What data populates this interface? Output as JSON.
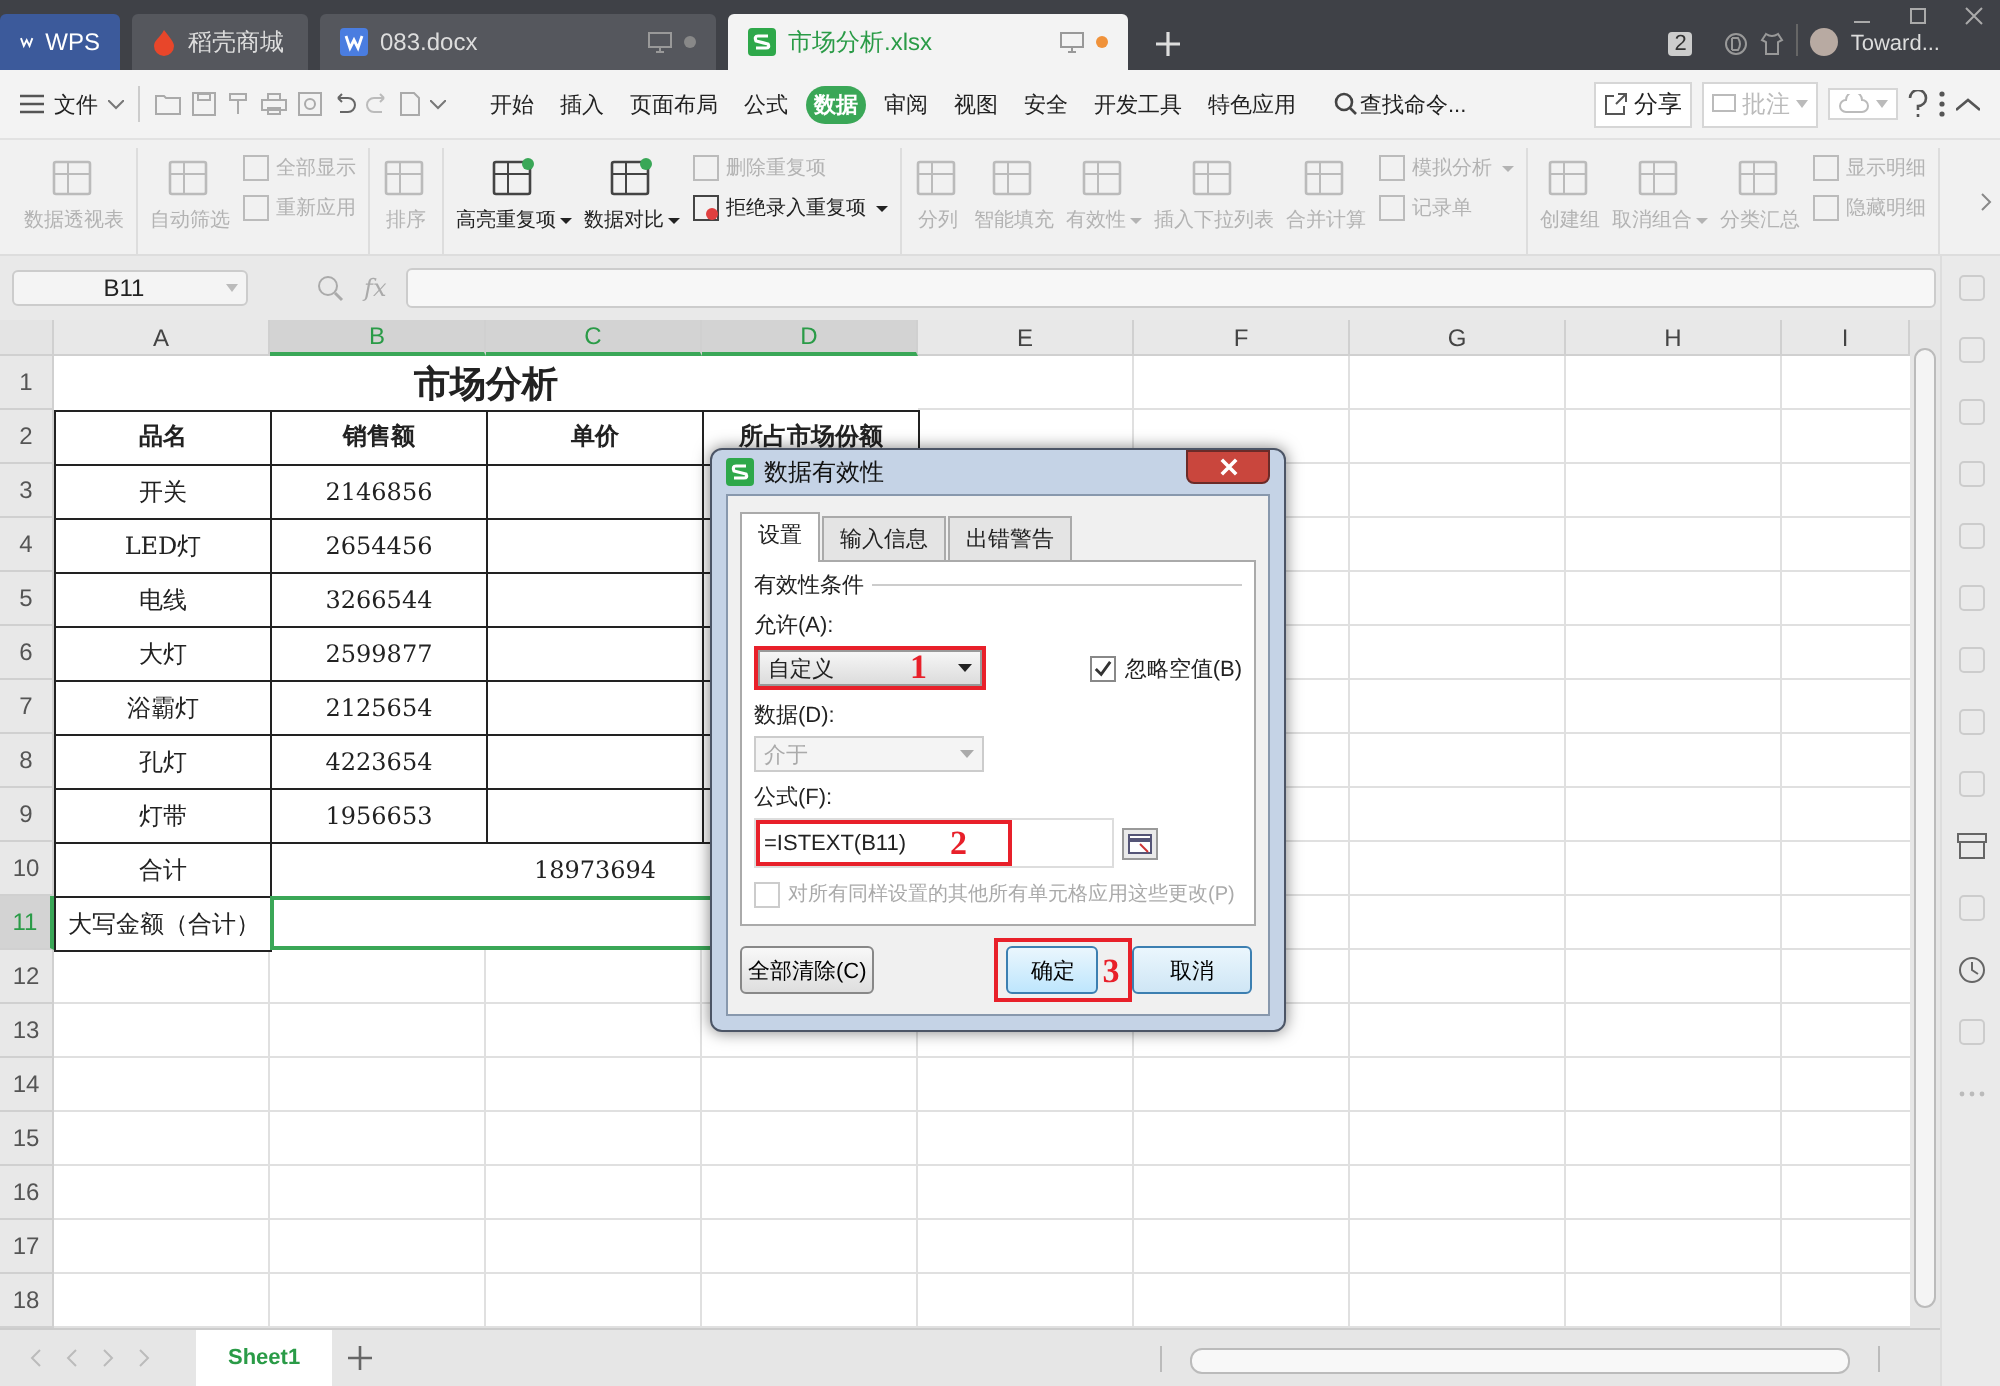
{
  "title_bar": {
    "tabs": [
      {
        "label": "WPS",
        "kind": "home",
        "selected": false
      },
      {
        "label": "稻壳商城",
        "kind": "store",
        "selected": false
      },
      {
        "label": "083.docx",
        "kind": "doc",
        "selected": false
      },
      {
        "label": "市场分析.xlsx",
        "kind": "sheet",
        "selected": true
      }
    ],
    "badge": "2",
    "user": "Toward..."
  },
  "menu_bar": {
    "file": "文件",
    "items": [
      {
        "label": "开始",
        "selected": false
      },
      {
        "label": "插入",
        "selected": false
      },
      {
        "label": "页面布局",
        "selected": false
      },
      {
        "label": "公式",
        "selected": false
      },
      {
        "label": "数据",
        "selected": true
      },
      {
        "label": "审阅",
        "selected": false
      },
      {
        "label": "视图",
        "selected": false
      },
      {
        "label": "安全",
        "selected": false
      },
      {
        "label": "开发工具",
        "selected": false
      },
      {
        "label": "特色应用",
        "selected": false
      }
    ],
    "search": "查找命令...",
    "share": "分享",
    "comment": "批注"
  },
  "ribbon": {
    "groups": [
      {
        "items": [
          {
            "kind": "large",
            "label": "数据透视表",
            "disabled": true,
            "dropdown": false
          }
        ]
      },
      {
        "items": [
          {
            "kind": "large",
            "label": "自动筛选",
            "disabled": true,
            "dropdown": false
          },
          {
            "kind": "stack",
            "items": [
              {
                "label": "全部显示",
                "disabled": true,
                "dropdown": false
              },
              {
                "label": "重新应用",
                "disabled": true,
                "dropdown": false
              }
            ]
          }
        ]
      },
      {
        "items": [
          {
            "kind": "large",
            "label": "排序",
            "disabled": true,
            "dropdown": false
          }
        ]
      },
      {
        "items": [
          {
            "kind": "large",
            "label": "高亮重复项",
            "disabled": false,
            "dropdown": true
          },
          {
            "kind": "large",
            "label": "数据对比",
            "disabled": false,
            "dropdown": true
          },
          {
            "kind": "stack",
            "items": [
              {
                "label": "删除重复项",
                "disabled": true,
                "dropdown": false
              },
              {
                "label": "拒绝录入重复项",
                "disabled": false,
                "dropdown": true
              }
            ]
          }
        ]
      },
      {
        "items": [
          {
            "kind": "large",
            "label": "分列",
            "disabled": true,
            "dropdown": false
          },
          {
            "kind": "large",
            "label": "智能填充",
            "disabled": true,
            "dropdown": false
          },
          {
            "kind": "large",
            "label": "有效性",
            "disabled": true,
            "dropdown": true
          },
          {
            "kind": "large",
            "label": "插入下拉列表",
            "disabled": true,
            "dropdown": false
          },
          {
            "kind": "large",
            "label": "合并计算",
            "disabled": true,
            "dropdown": false
          },
          {
            "kind": "stack",
            "items": [
              {
                "label": "模拟分析",
                "disabled": true,
                "dropdown": true
              },
              {
                "label": "记录单",
                "disabled": true,
                "dropdown": false
              }
            ]
          }
        ]
      },
      {
        "items": [
          {
            "kind": "large",
            "label": "创建组",
            "disabled": true,
            "dropdown": false
          },
          {
            "kind": "large",
            "label": "取消组合",
            "disabled": true,
            "dropdown": true
          },
          {
            "kind": "large",
            "label": "分类汇总",
            "disabled": true,
            "dropdown": false
          },
          {
            "kind": "stack",
            "items": [
              {
                "label": "显示明细",
                "disabled": true,
                "dropdown": false
              },
              {
                "label": "隐藏明细",
                "disabled": true,
                "dropdown": false
              }
            ]
          }
        ]
      }
    ]
  },
  "formula_bar": {
    "cell": "B11",
    "fx": "fx"
  },
  "sheet": {
    "columns": [
      {
        "label": "A",
        "selected": false
      },
      {
        "label": "B",
        "selected": true
      },
      {
        "label": "C",
        "selected": true
      },
      {
        "label": "D",
        "selected": true
      },
      {
        "label": "E",
        "selected": false
      },
      {
        "label": "F",
        "selected": false
      },
      {
        "label": "G",
        "selected": false
      },
      {
        "label": "H",
        "selected": false
      },
      {
        "label": "I",
        "selected": false
      }
    ],
    "row_numbers": [
      {
        "label": "1",
        "selected": false
      },
      {
        "label": "2",
        "selected": false
      },
      {
        "label": "3",
        "selected": false
      },
      {
        "label": "4",
        "selected": false
      },
      {
        "label": "5",
        "selected": false
      },
      {
        "label": "6",
        "selected": false
      },
      {
        "label": "7",
        "selected": false
      },
      {
        "label": "8",
        "selected": false
      },
      {
        "label": "9",
        "selected": false
      },
      {
        "label": "10",
        "selected": false
      },
      {
        "label": "11",
        "selected": true
      },
      {
        "label": "12",
        "selected": false
      },
      {
        "label": "13",
        "selected": false
      },
      {
        "label": "14",
        "selected": false
      },
      {
        "label": "15",
        "selected": false
      },
      {
        "label": "16",
        "selected": false
      },
      {
        "label": "17",
        "selected": false
      },
      {
        "label": "18",
        "selected": false
      }
    ],
    "title": "市场分析",
    "header": [
      "品名",
      "销售额",
      "单价",
      "所占市场份额"
    ],
    "rows": [
      [
        "开关",
        "2146856"
      ],
      [
        "LED灯",
        "2654456"
      ],
      [
        "电线",
        "3266544"
      ],
      [
        "大灯",
        "2599877"
      ],
      [
        "浴霸灯",
        "2125654"
      ],
      [
        "孔灯",
        "4223654"
      ],
      [
        "灯带",
        "1956653"
      ]
    ],
    "total": {
      "label": "合计",
      "value": "18973694"
    },
    "amount": {
      "label": "大写金额（合计）",
      "selected": true
    },
    "tabs": [
      {
        "label": "Sheet1",
        "selected": true
      }
    ]
  },
  "dialog": {
    "title": "数据有效性",
    "tabs": [
      {
        "label": "设置",
        "selected": true
      },
      {
        "label": "输入信息",
        "selected": false
      },
      {
        "label": "出错警告",
        "selected": false
      }
    ],
    "section": "有效性条件",
    "allow": {
      "label": "允许(A):",
      "value": "自定义",
      "step": "1"
    },
    "ignore_blank": {
      "label": "忽略空值(B)",
      "checked": true
    },
    "data": {
      "label": "数据(D):",
      "value": "介于",
      "disabled": true
    },
    "formula": {
      "label": "公式(F):",
      "value": "=ISTEXT(B11)",
      "step": "2"
    },
    "apply_all": {
      "label": "对所有同样设置的其他所有单元格应用这些更改(P)",
      "checked": false,
      "disabled": true
    },
    "buttons": [
      {
        "label": "全部清除(C)",
        "kind": "clear"
      },
      {
        "label": "确定",
        "kind": "ok",
        "step": "3"
      },
      {
        "label": "取消",
        "kind": "cancel"
      }
    ]
  }
}
